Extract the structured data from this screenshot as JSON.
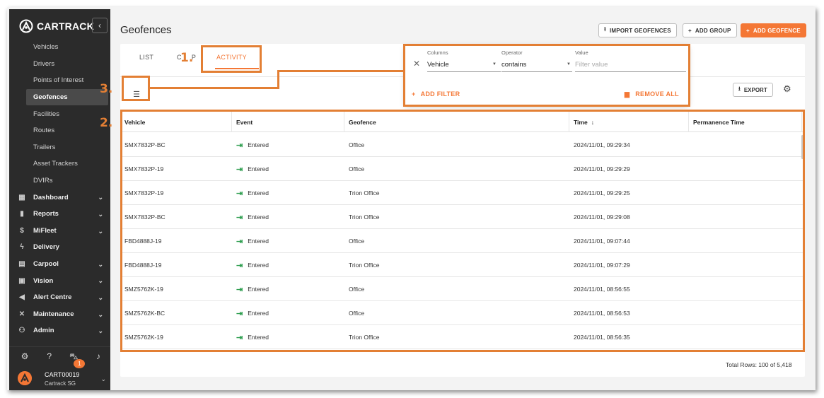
{
  "sidebar": {
    "logo_text": "CARTRACK",
    "collapse_icon": "chevron-left-icon",
    "sub_items": [
      "Vehicles",
      "Drivers",
      "Points of Interest",
      "Geofences",
      "Facilities",
      "Routes",
      "Trailers",
      "Asset Trackers",
      "DVIRs"
    ],
    "active_item": "Geofences",
    "main_items": [
      {
        "label": "Dashboard",
        "icon": "dashboard-icon",
        "glyph": "▦",
        "chevron": true
      },
      {
        "label": "Reports",
        "icon": "reports-icon",
        "glyph": "▮",
        "chevron": true
      },
      {
        "label": "MiFleet",
        "icon": "dollar-icon",
        "glyph": "$",
        "chevron": true
      },
      {
        "label": "Delivery",
        "icon": "bolt-icon",
        "glyph": "ϟ",
        "chevron": false
      },
      {
        "label": "Carpool",
        "icon": "calendar-icon",
        "glyph": "▤",
        "chevron": true
      },
      {
        "label": "Vision",
        "icon": "video-icon",
        "glyph": "▣",
        "chevron": true
      },
      {
        "label": "Alert Centre",
        "icon": "megaphone-icon",
        "glyph": "◀",
        "chevron": true
      },
      {
        "label": "Maintenance",
        "icon": "tools-icon",
        "glyph": "✕",
        "chevron": true
      },
      {
        "label": "Admin",
        "icon": "admin-icon",
        "glyph": "⚇",
        "chevron": true
      }
    ],
    "notification_count": "1",
    "account_name": "CART00019",
    "account_org": "Cartrack SG"
  },
  "header": {
    "title": "Geofences",
    "import_label": "IMPORT GEOFENCES",
    "add_group_label": "ADD GROUP",
    "add_geofence_label": "ADD GEOFENCE"
  },
  "tabs": {
    "list": "LIST",
    "group_partial": "C",
    "group_partial_end": "P",
    "activity": "ACTIVITY"
  },
  "filter": {
    "columns_label": "Columns",
    "columns_value": "Vehicle",
    "operator_label": "Operator",
    "operator_value": "contains",
    "value_label": "Value",
    "value_placeholder": "Filter value",
    "add_filter_label": "ADD FILTER",
    "remove_all_label": "REMOVE ALL"
  },
  "toolbar": {
    "export_label": "EXPORT"
  },
  "table": {
    "columns": [
      "Vehicle",
      "Event",
      "Geofence",
      "Time",
      "Permanence Time"
    ],
    "sort_indicator": "↓",
    "rows": [
      {
        "vehicle": "SMX7832P-BC",
        "event": "Entered",
        "geofence": "Office",
        "time": "2024/11/01, 09:29:34"
      },
      {
        "vehicle": "SMX7832P-19",
        "event": "Entered",
        "geofence": "Office",
        "time": "2024/11/01, 09:29:29"
      },
      {
        "vehicle": "SMX7832P-19",
        "event": "Entered",
        "geofence": "Trion Office",
        "time": "2024/11/01, 09:29:25"
      },
      {
        "vehicle": "SMX7832P-BC",
        "event": "Entered",
        "geofence": "Trion Office",
        "time": "2024/11/01, 09:29:08"
      },
      {
        "vehicle": "FBD4888J-19",
        "event": "Entered",
        "geofence": "Office",
        "time": "2024/11/01, 09:07:44"
      },
      {
        "vehicle": "FBD4888J-19",
        "event": "Entered",
        "geofence": "Trion Office",
        "time": "2024/11/01, 09:07:29"
      },
      {
        "vehicle": "SMZ5762K-19",
        "event": "Entered",
        "geofence": "Office",
        "time": "2024/11/01, 08:56:55"
      },
      {
        "vehicle": "SMZ5762K-BC",
        "event": "Entered",
        "geofence": "Office",
        "time": "2024/11/01, 08:56:53"
      },
      {
        "vehicle": "SMZ5762K-19",
        "event": "Entered",
        "geofence": "Trion Office",
        "time": "2024/11/01, 08:56:35"
      }
    ],
    "total_rows": "Total Rows: 100 of 5,418"
  },
  "annotations": {
    "marker_1": "1.",
    "marker_2": "2.",
    "marker_3": "3.",
    "highlight_color": "#e37f34"
  },
  "colors": {
    "accent": "#f47735",
    "sidebar_bg": "#2b2b2b",
    "entered_icon": "#2e9e4f"
  }
}
